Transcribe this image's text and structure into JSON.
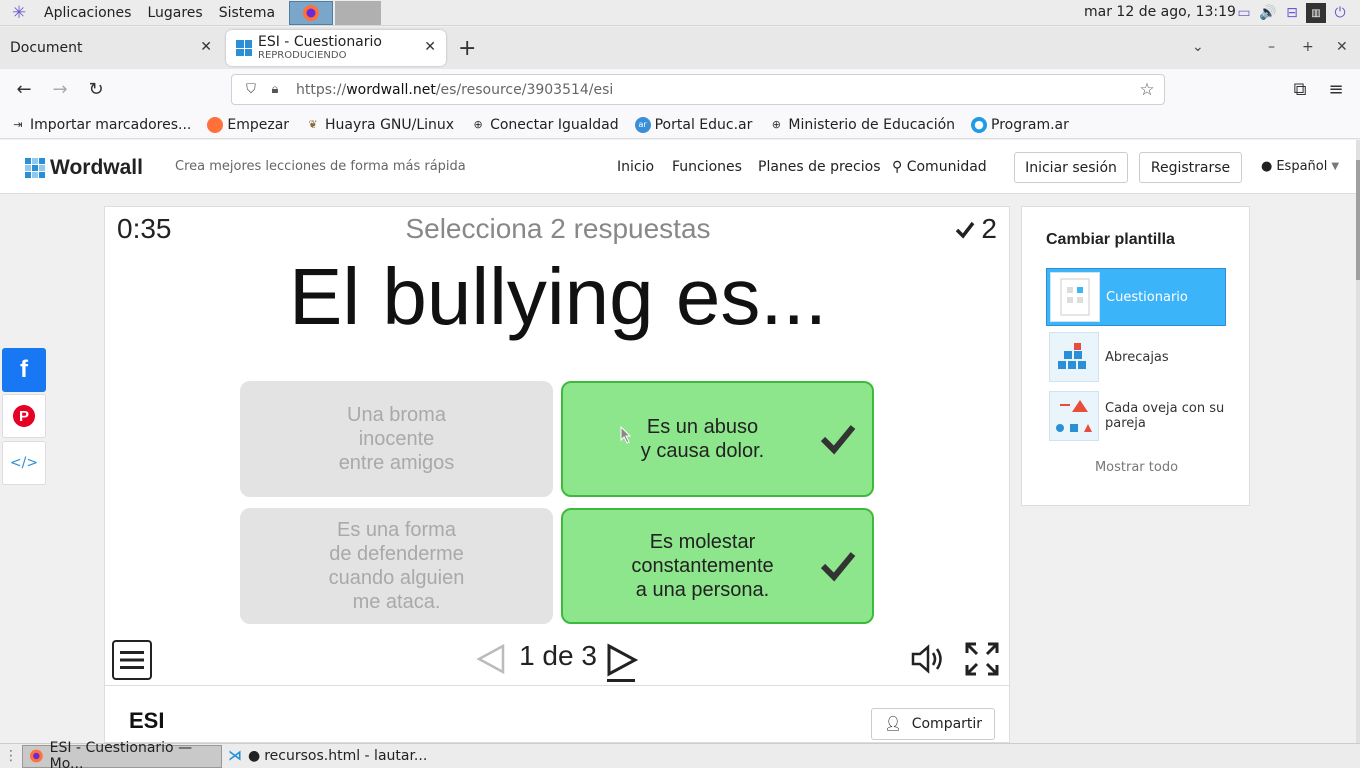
{
  "system_panel": {
    "menus": [
      "Aplicaciones",
      "Lugares",
      "Sistema"
    ],
    "clock": "mar 12 de ago, 13:19"
  },
  "browser": {
    "tabs": [
      {
        "title": "Document",
        "subtitle": ""
      },
      {
        "title": "ESI - Cuestionario",
        "subtitle": "REPRODUCIENDO"
      }
    ],
    "new_tab_icon": "+",
    "url": {
      "prefix": "https://",
      "domain": "wordwall.net",
      "path": "/es/resource/3903514/esi"
    },
    "bookmarks": [
      "Importar marcadores...",
      "Empezar",
      "Huayra GNU/Linux",
      "Conectar Igualdad",
      "Portal Educ.ar",
      "Ministerio de Educación",
      "Program.ar"
    ]
  },
  "site": {
    "brand": "Wordwall",
    "tagline": "Crea mejores lecciones de forma más rápida",
    "nav": [
      "Inicio",
      "Funciones",
      "Planes de precios",
      "Comunidad"
    ],
    "login": "Iniciar sesión",
    "register": "Registrarse",
    "language": "Español"
  },
  "game": {
    "timer": "0:35",
    "instruction": "Selecciona 2 respuestas",
    "score": "2",
    "question": "El bullying es...",
    "answers": [
      {
        "lines": [
          "Una broma",
          "inocente",
          "entre amigos"
        ],
        "selected": false
      },
      {
        "lines": [
          "Es un abuso",
          "y causa dolor."
        ],
        "selected": true
      },
      {
        "lines": [
          "Es una forma",
          "de defenderme",
          "cuando alguien",
          "me ataca."
        ],
        "selected": false
      },
      {
        "lines": [
          "Es molestar",
          "constantemente",
          "a una persona."
        ],
        "selected": true
      }
    ],
    "pager": "1 de 3"
  },
  "resource": {
    "title": "ESI",
    "share": "Compartir"
  },
  "sidebar": {
    "title": "Cambiar plantilla",
    "templates": [
      {
        "name": "Cuestionario",
        "selected": true
      },
      {
        "name": "Abrecajas",
        "selected": false
      },
      {
        "name": "Cada oveja con su pareja",
        "selected": false
      }
    ],
    "show_all": "Mostrar todo"
  },
  "taskbar": {
    "items": [
      "ESI - Cuestionario — Mo...",
      "recursos.html - lautar..."
    ]
  },
  "colors": {
    "correct_fill": "#8de68b",
    "correct_border": "#3dba3b",
    "unselected_fill": "#e3e3e3",
    "template_selected": "#3cb4fa",
    "brand_blue": "#2a8fd6",
    "facebook": "#1877f2",
    "pinterest": "#e60023"
  }
}
